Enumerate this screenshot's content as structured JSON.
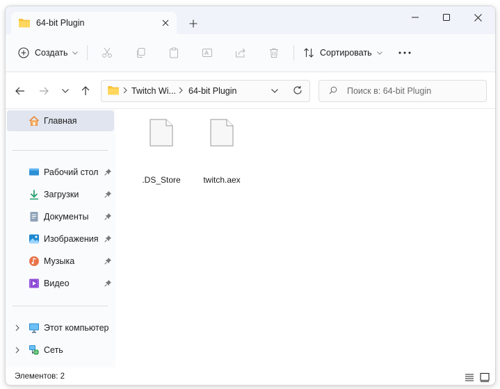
{
  "tab": {
    "title": "64-bit Plugin"
  },
  "toolbar": {
    "new_label": "Создать",
    "sort_label": "Сортировать"
  },
  "address": {
    "crumbs": [
      "Twitch Wi...",
      "64-bit Plugin"
    ]
  },
  "search": {
    "placeholder": "Поиск в: 64-bit Plugin"
  },
  "sidebar": {
    "home": "Главная",
    "quick_access": [
      {
        "label": "Рабочий стол",
        "icon": "desktop-icon"
      },
      {
        "label": "Загрузки",
        "icon": "download-icon"
      },
      {
        "label": "Документы",
        "icon": "documents-icon"
      },
      {
        "label": "Изображения",
        "icon": "pictures-icon"
      },
      {
        "label": "Музыка",
        "icon": "music-icon"
      },
      {
        "label": "Видео",
        "icon": "video-icon"
      }
    ],
    "this_pc": "Этот компьютер",
    "network": "Сеть"
  },
  "files": [
    {
      "name": ".DS_Store"
    },
    {
      "name": "twitch.aex"
    }
  ],
  "status": {
    "count": "Элементов: 2"
  },
  "colors": {
    "accent": "#0067c0",
    "folder": "#f5c33b",
    "selected": "#e0e5ef"
  }
}
